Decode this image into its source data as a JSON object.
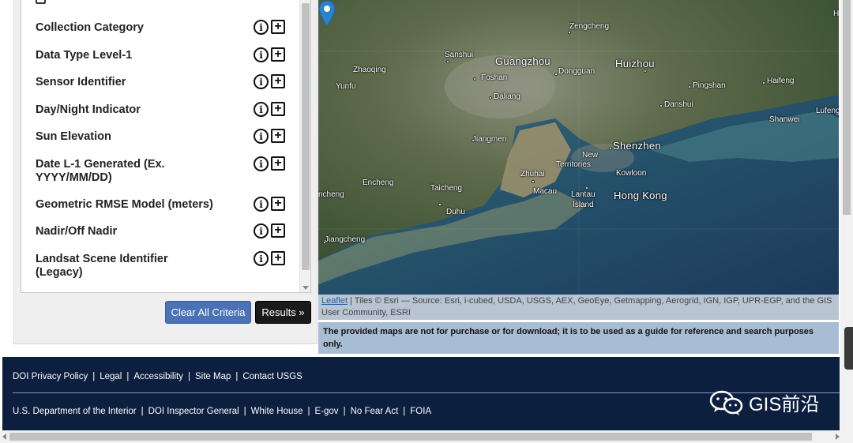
{
  "criteria": {
    "items": [
      {
        "label": "Collection Category"
      },
      {
        "label": "Data Type Level-1"
      },
      {
        "label": "Sensor Identifier"
      },
      {
        "label": "Day/Night Indicator"
      },
      {
        "label": "Sun Elevation"
      },
      {
        "label": "Date L-1 Generated (Ex. YYYY/MM/DD)"
      },
      {
        "label": "Geometric RMSE Model (meters)"
      },
      {
        "label": "Nadir/Off Nadir"
      },
      {
        "label": "Landsat Scene Identifier (Legacy)"
      }
    ],
    "info_glyph": "i",
    "add_glyph": "+"
  },
  "buttons": {
    "clear_label": "Clear All Criteria",
    "results_label": "Results »"
  },
  "map": {
    "labels": {
      "zengcheng": "Zengcheng",
      "sanshui": "Sanshui",
      "guangzhou": "Guangzhou",
      "zhaoqing": "Zhaoqing",
      "huizhou": "Huizhou",
      "yunfu": "Yunfu",
      "foshan": "Foshan",
      "dongguan": "Dongguan",
      "pingshan": "Pingshan",
      "haifeng": "Haifeng",
      "daliang": "Daliang",
      "danshui": "Danshui",
      "lufeng": "Lufeng",
      "shanwei": "Shanwei",
      "jiangmen": "Jiangmen",
      "shenzhen": "Shenzhen",
      "new_territories_1": "New",
      "new_territories_2": "Territories",
      "zhuhai": "Zhuhai",
      "kowloon": "Kowloon",
      "encheng": "Encheng",
      "taicheng": "Taicheng",
      "macau": "Macau",
      "lantau_1": "Lantau",
      "lantau_2": "Island",
      "hong_kong": "Hong Kong",
      "cheng": "ncheng",
      "duhu": "Duhu",
      "jiangcheng": "Jiangcheng",
      "edge_h": "H"
    },
    "attribution_link": "Leaflet",
    "attribution_text": " | Tiles © Esri — Source: Esri, i-cubed, USDA, USGS, AEX, GeoEye, Getmapping, Aerogrid, IGN, IGP, UPR-EGP, and the GIS User Community, ESRI",
    "notice": "The provided maps are not for purchase or for download; it is to be used as a guide for reference and search purposes only."
  },
  "footer": {
    "row1": [
      "DOI Privacy Policy",
      "Legal",
      "Accessibility",
      "Site Map",
      "Contact USGS"
    ],
    "row2": [
      "U.S. Department of the Interior",
      "DOI Inspector General",
      "White House",
      "E-gov",
      "No Fear Act",
      "FOIA"
    ],
    "separator": "|",
    "brand": "GIS前沿"
  }
}
